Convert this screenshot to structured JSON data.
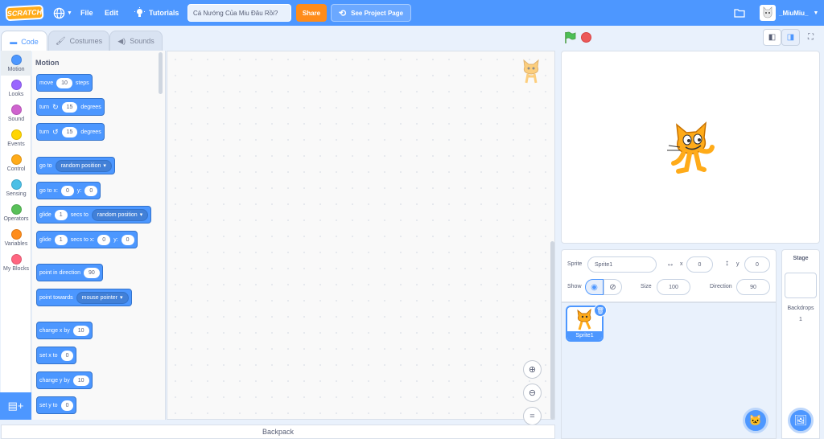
{
  "menubar": {
    "logo": "SCRATCH",
    "globe_icon": "globe-icon",
    "file": "File",
    "edit": "Edit",
    "tutorials": "Tutorials",
    "project_title": "Cá Nướng Của Miu Đâu Rồi?",
    "share": "Share",
    "see_project": "See Project Page",
    "username": "_MiuMiu_"
  },
  "tabs": {
    "code": "Code",
    "costumes": "Costumes",
    "sounds": "Sounds"
  },
  "categories": [
    {
      "label": "Motion",
      "color": "#4c97ff"
    },
    {
      "label": "Looks",
      "color": "#9966ff"
    },
    {
      "label": "Sound",
      "color": "#cf63cf"
    },
    {
      "label": "Events",
      "color": "#ffd500"
    },
    {
      "label": "Control",
      "color": "#ffab19"
    },
    {
      "label": "Sensing",
      "color": "#4cbfe6"
    },
    {
      "label": "Operators",
      "color": "#59c059"
    },
    {
      "label": "Variables",
      "color": "#ff8c1a"
    },
    {
      "label": "My Blocks",
      "color": "#ff6680"
    }
  ],
  "palette": {
    "heading": "Motion",
    "move": {
      "a": "move",
      "v": "10",
      "b": "steps"
    },
    "turn_cw": {
      "a": "turn",
      "v": "15",
      "b": "degrees"
    },
    "turn_ccw": {
      "a": "turn",
      "v": "15",
      "b": "degrees"
    },
    "goto": {
      "a": "go to",
      "dd": "random position"
    },
    "gotoxy": {
      "a": "go to x:",
      "x": "0",
      "b": "y:",
      "y": "0"
    },
    "glide": {
      "a": "glide",
      "v": "1",
      "b": "secs to",
      "dd": "random position"
    },
    "glidexy": {
      "a": "glide",
      "v": "1",
      "b": "secs to x:",
      "x": "0",
      "c": "y:",
      "y": "0"
    },
    "pointdir": {
      "a": "point in direction",
      "v": "90"
    },
    "pointtowards": {
      "a": "point towards",
      "dd": "mouse pointer"
    },
    "changex": {
      "a": "change x by",
      "v": "10"
    },
    "setx": {
      "a": "set x to",
      "v": "0"
    },
    "changey": {
      "a": "change y by",
      "v": "10"
    },
    "sety": {
      "a": "set y to",
      "v": "0"
    }
  },
  "backpack": "Backpack",
  "sprite_info": {
    "sprite_label": "Sprite",
    "sprite_name": "Sprite1",
    "x_label": "x",
    "x": "0",
    "y_label": "y",
    "y": "0",
    "show_label": "Show",
    "size_label": "Size",
    "size": "100",
    "direction_label": "Direction",
    "direction": "90"
  },
  "sprites": [
    {
      "name": "Sprite1"
    }
  ],
  "stage_pane": {
    "title": "Stage",
    "backdrops_label": "Backdrops",
    "backdrops_count": "1"
  }
}
